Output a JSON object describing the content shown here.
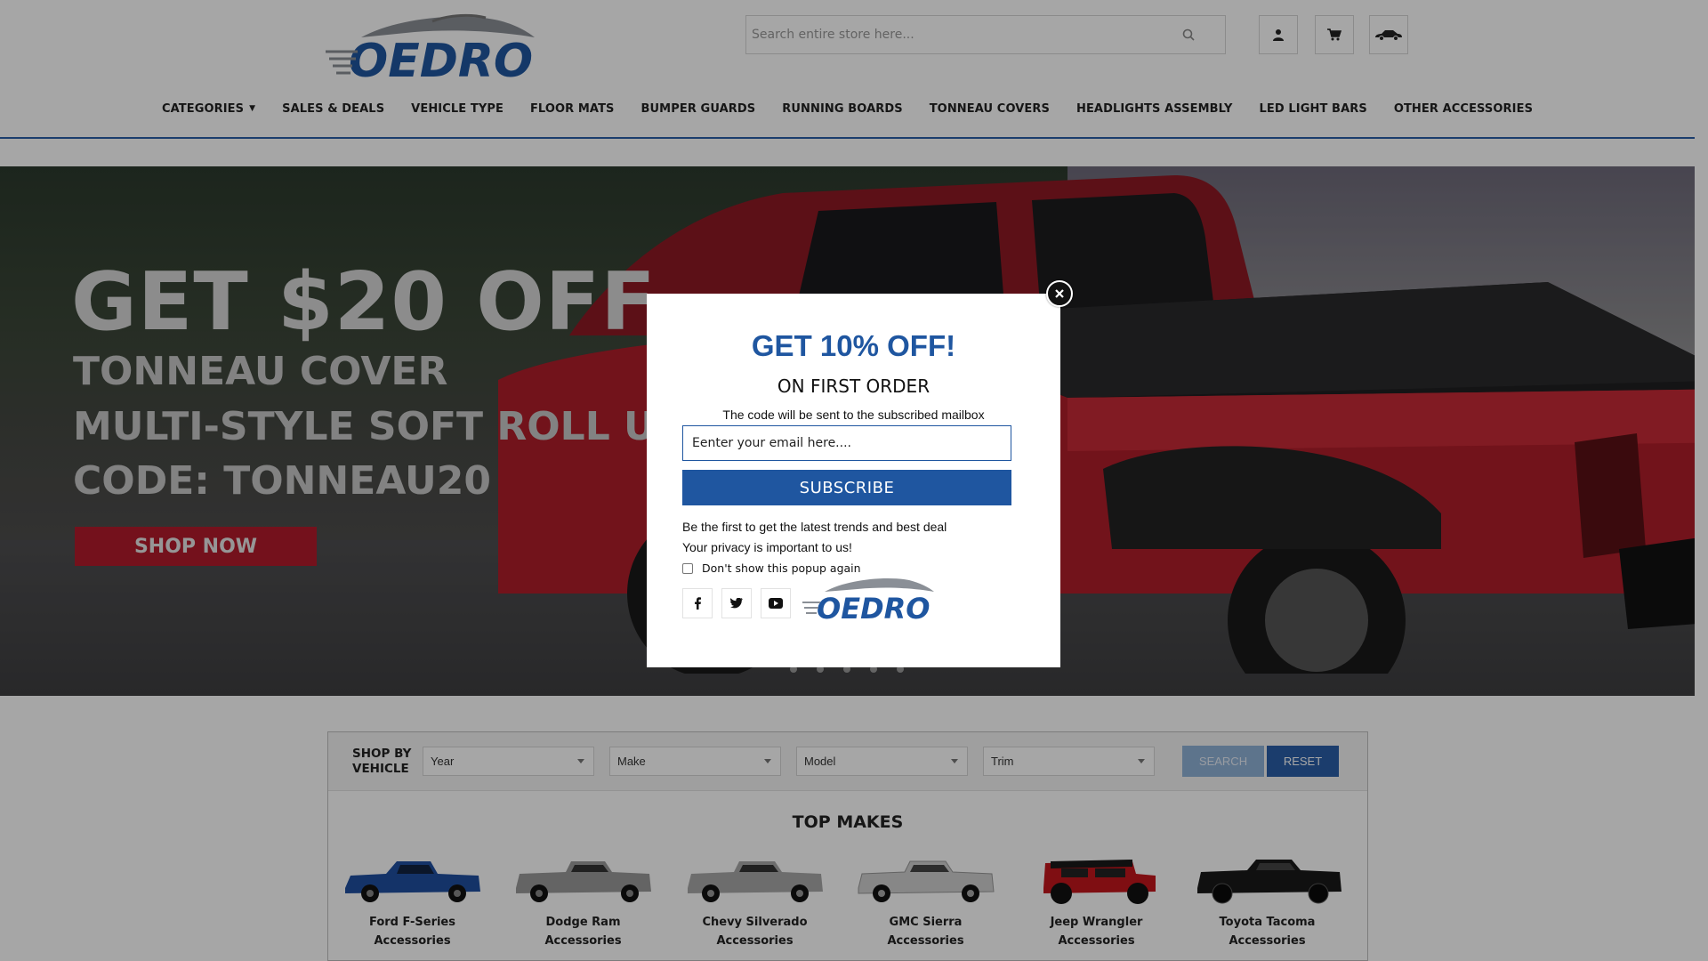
{
  "header": {
    "logo_text": "OEDRO",
    "search_placeholder": "Search entire store here...",
    "icons": [
      "search-icon",
      "account-icon",
      "cart-icon",
      "vehicle-garage-icon"
    ]
  },
  "nav": {
    "items": [
      {
        "label": "CATEGORIES",
        "has_dropdown": true
      },
      {
        "label": "SALES & DEALS"
      },
      {
        "label": "VEHICLE TYPE"
      },
      {
        "label": "FLOOR MATS"
      },
      {
        "label": "BUMPER GUARDS"
      },
      {
        "label": "RUNNING BOARDS"
      },
      {
        "label": "TONNEAU COVERS"
      },
      {
        "label": "HEADLIGHTS ASSEMBLY"
      },
      {
        "label": "LED LIGHT BARS"
      },
      {
        "label": "OTHER ACCESSORIES"
      }
    ]
  },
  "hero": {
    "title": "GET $20 OFF",
    "line1": "TONNEAU COVER",
    "line2": "MULTI-STYLE SOFT ROLL UP/3-F",
    "line3": "CODE: TONNEAU20",
    "cta": "SHOP NOW",
    "slides": 5
  },
  "finder": {
    "label_line1": "SHOP BY",
    "label_line2": "VEHICLE",
    "selects": [
      "Year",
      "Make",
      "Model",
      "Trim"
    ],
    "search_label": "SEARCH",
    "reset_label": "RESET",
    "top_makes_title": "TOP MAKES",
    "makes": [
      {
        "name": "Ford F-Series",
        "sub": "Accessories",
        "color": "#1f4fa0"
      },
      {
        "name": "Dodge Ram",
        "sub": "Accessories",
        "color": "#9a9a9a"
      },
      {
        "name": "Chevy Silverado",
        "sub": "Accessories",
        "color": "#a8a8a8"
      },
      {
        "name": "GMC Sierra",
        "sub": "Accessories",
        "color": "#cfcfcf"
      },
      {
        "name": "Jeep Wrangler",
        "sub": "Accessories",
        "color": "#c4161c"
      },
      {
        "name": "Toyota Tacoma",
        "sub": "Accessories",
        "color": "#1a1a1a"
      }
    ]
  },
  "popup": {
    "title": "GET 10% OFF!",
    "subtitle": "ON FIRST ORDER",
    "note": "The code will be sent to the subscribed mailbox",
    "email_placeholder": "Eenter your email here....",
    "subscribe_label": "SUBSCRIBE",
    "text1": "Be the first to get the latest trends and best deal",
    "text2": "Your privacy is important to us!",
    "checkbox_label": "Don't show this popup again",
    "social": [
      "facebook-icon",
      "twitter-icon",
      "youtube-icon"
    ],
    "accent": "#1f56a0"
  }
}
